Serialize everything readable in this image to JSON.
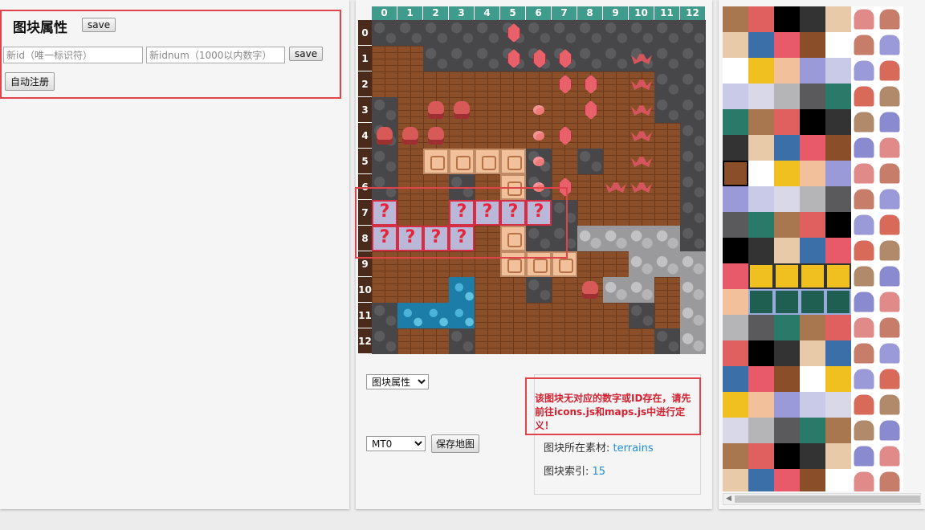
{
  "left_panel": {
    "title": "图块属性",
    "save_label": "save",
    "id_placeholder": "新id（唯一标识符）",
    "idnum_placeholder": "新idnum（1000以内数字）",
    "save2_label": "save",
    "autoreg_label": "自动注册"
  },
  "map": {
    "col_headers": [
      "0",
      "1",
      "2",
      "3",
      "4",
      "5",
      "6",
      "7",
      "8",
      "9",
      "10",
      "11",
      "12"
    ],
    "row_headers": [
      "0",
      "1",
      "2",
      "3",
      "4",
      "5",
      "6",
      "7",
      "8",
      "9",
      "10",
      "11",
      "12"
    ],
    "question_mark": "?",
    "rows": [
      "ggggggggggggg",
      "wwggggggggggg",
      "wwwwwwwwwwwgg",
      "gwwwwwwwwwwgg",
      "gwwwwwwwwwwwg",
      "gwffffgwgwwwg",
      "gwwgwfgwwwwwg",
      "qwwqqqqgwwwwg",
      "qqqqwfggssssg",
      "wwwwwfffwwsss",
      "wwwawwgwwssws",
      "gaaawwwwwwgws",
      "gwwgwwwwwwwgs"
    ],
    "units": [
      [
        0,
        5,
        "gem"
      ],
      [
        1,
        5,
        "gem"
      ],
      [
        1,
        6,
        "gem"
      ],
      [
        1,
        7,
        "gem"
      ],
      [
        1,
        10,
        "bat"
      ],
      [
        2,
        7,
        "gem"
      ],
      [
        2,
        8,
        "gem"
      ],
      [
        2,
        10,
        "bat"
      ],
      [
        3,
        2,
        "orc"
      ],
      [
        3,
        3,
        "orc"
      ],
      [
        3,
        6,
        "sl"
      ],
      [
        3,
        8,
        "gem"
      ],
      [
        3,
        10,
        "bat"
      ],
      [
        4,
        0,
        "orc"
      ],
      [
        4,
        1,
        "orc"
      ],
      [
        4,
        2,
        "orc"
      ],
      [
        4,
        6,
        "sl"
      ],
      [
        4,
        7,
        "gem"
      ],
      [
        4,
        10,
        "bat"
      ],
      [
        5,
        6,
        "sl"
      ],
      [
        5,
        10,
        "bat"
      ],
      [
        6,
        6,
        "sl"
      ],
      [
        6,
        7,
        "gem"
      ],
      [
        6,
        9,
        "bat"
      ],
      [
        6,
        10,
        "bat"
      ],
      [
        10,
        8,
        "orc"
      ]
    ]
  },
  "bottom": {
    "select_attr": "图块属性",
    "select_map": "MT0",
    "save_map_label": "保存地图"
  },
  "info": {
    "warning": "该图块无对应的数字或ID存在，请先前往icons.js和maps.js中进行定义！",
    "material_label": "图块所在素材:",
    "material_value": "terrains",
    "index_label": "图块索引:",
    "index_value": "15"
  },
  "colors": {
    "accent_red": "#e0434a",
    "header_teal": "#3f9b8b",
    "link_blue": "#1e8fd6"
  }
}
